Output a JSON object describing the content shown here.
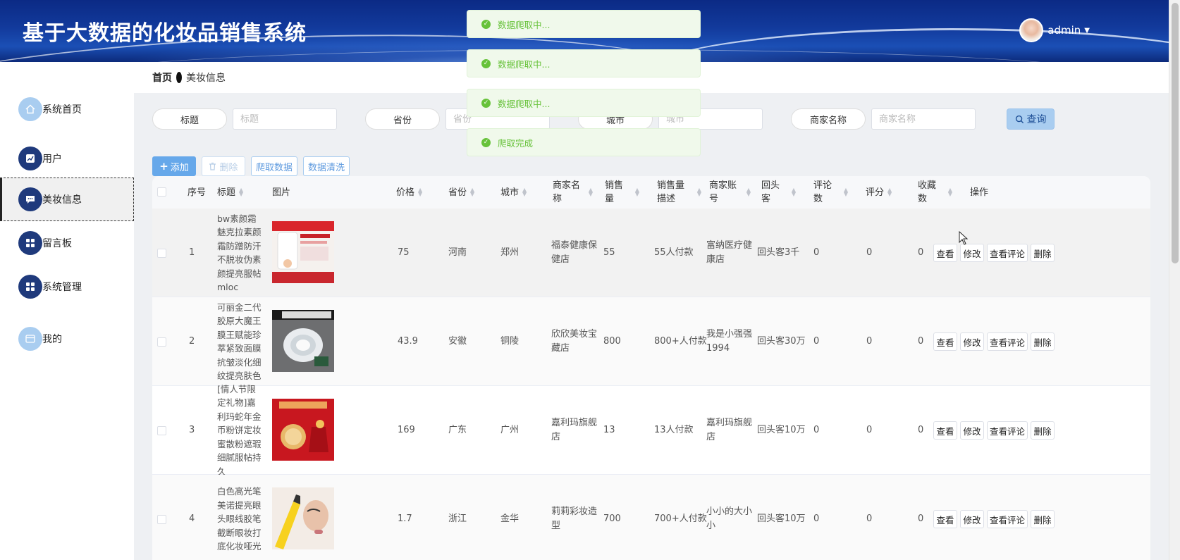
{
  "app": {
    "title": "基于大数据的化妆品销售系统",
    "user": "admin"
  },
  "sidebar": {
    "items": [
      {
        "label": "系统首页",
        "icon": "home-icon"
      },
      {
        "label": "用户",
        "icon": "chart-icon"
      },
      {
        "label": "美妆信息",
        "icon": "message-icon"
      },
      {
        "label": "留言板",
        "icon": "grid-icon"
      },
      {
        "label": "系统管理",
        "icon": "grid-icon"
      },
      {
        "label": "我的",
        "icon": "card-icon"
      }
    ]
  },
  "breadcrumb": {
    "home": "首页",
    "current": "美妆信息"
  },
  "search": {
    "title_label": "标题",
    "title_placeholder": "标题",
    "province_label": "省份",
    "province_placeholder": "省份",
    "city_label": "城市",
    "city_placeholder": "城市",
    "merchant_label": "商家名称",
    "merchant_placeholder": "商家名称",
    "query": "查询"
  },
  "toolbar": {
    "add": "添加",
    "delete": "删除",
    "crawl": "爬取数据",
    "clean": "数据清洗"
  },
  "table": {
    "headers": {
      "index": "序号",
      "title": "标题",
      "image": "图片",
      "price": "价格",
      "province": "省份",
      "city": "城市",
      "merchant": "商家名称",
      "sales": "销售量",
      "sales_desc": "销售量描述",
      "account": "商家账号",
      "repeat": "回头客",
      "comments": "评论数",
      "rating": "评分",
      "favorites": "收藏数",
      "actions": "操作"
    },
    "rows": [
      {
        "index": "1",
        "title": "bw素颜霜魅克拉素颜霜防蹭防汗不脱妆伪素颜提亮服帖mloc",
        "price": "75",
        "province": "河南",
        "city": "郑州",
        "merchant": "福泰健康保健店",
        "sales": "55",
        "sales_desc": "55人付款",
        "account": "富纳医疗健康店",
        "repeat": "回头客3千",
        "comments": "0",
        "rating": "0",
        "favorites": "0"
      },
      {
        "index": "2",
        "title": "可丽金二代胶原大魔王膜王赋能珍萃紧致面膜抗皱淡化细纹提亮肤色",
        "price": "43.9",
        "province": "安徽",
        "city": "铜陵",
        "merchant": "欣欣美妆宝藏店",
        "sales": "800",
        "sales_desc": "800+人付款",
        "account": "我是小强强1994",
        "repeat": "回头客30万",
        "comments": "0",
        "rating": "0",
        "favorites": "0"
      },
      {
        "index": "3",
        "title": "[情人节限定礼物]嘉利玛蛇年金币粉饼定妆蜜散粉遮瑕细腻服帖持久",
        "price": "169",
        "province": "广东",
        "city": "广州",
        "merchant": "嘉利玛旗舰店",
        "sales": "13",
        "sales_desc": "13人付款",
        "account": "嘉利玛旗舰店",
        "repeat": "回头客10万",
        "comments": "0",
        "rating": "0",
        "favorites": "0"
      },
      {
        "index": "4",
        "title": "白色高光笔美诺提亮眼头眼线胶笔截断眼妆打底化妆哑光",
        "price": "1.7",
        "province": "浙江",
        "city": "金华",
        "merchant": "莉莉彩妆造型",
        "sales": "700",
        "sales_desc": "700+人付款",
        "account": "小小的大小小",
        "repeat": "回头客10万",
        "comments": "0",
        "rating": "0",
        "favorites": "0"
      }
    ],
    "actions": {
      "view": "查看",
      "edit": "修改",
      "view_comments": "查看评论",
      "delete": "删除"
    }
  },
  "toasts": [
    "数据爬取中...",
    "数据爬取中...",
    "数据爬取中...",
    "爬取完成"
  ],
  "colors": {
    "header": "#123a9c",
    "accent": "#66a8ea",
    "success": "#67c23a",
    "nav_dark": "#1f3a7c",
    "nav_light": "#a9cdf0"
  }
}
